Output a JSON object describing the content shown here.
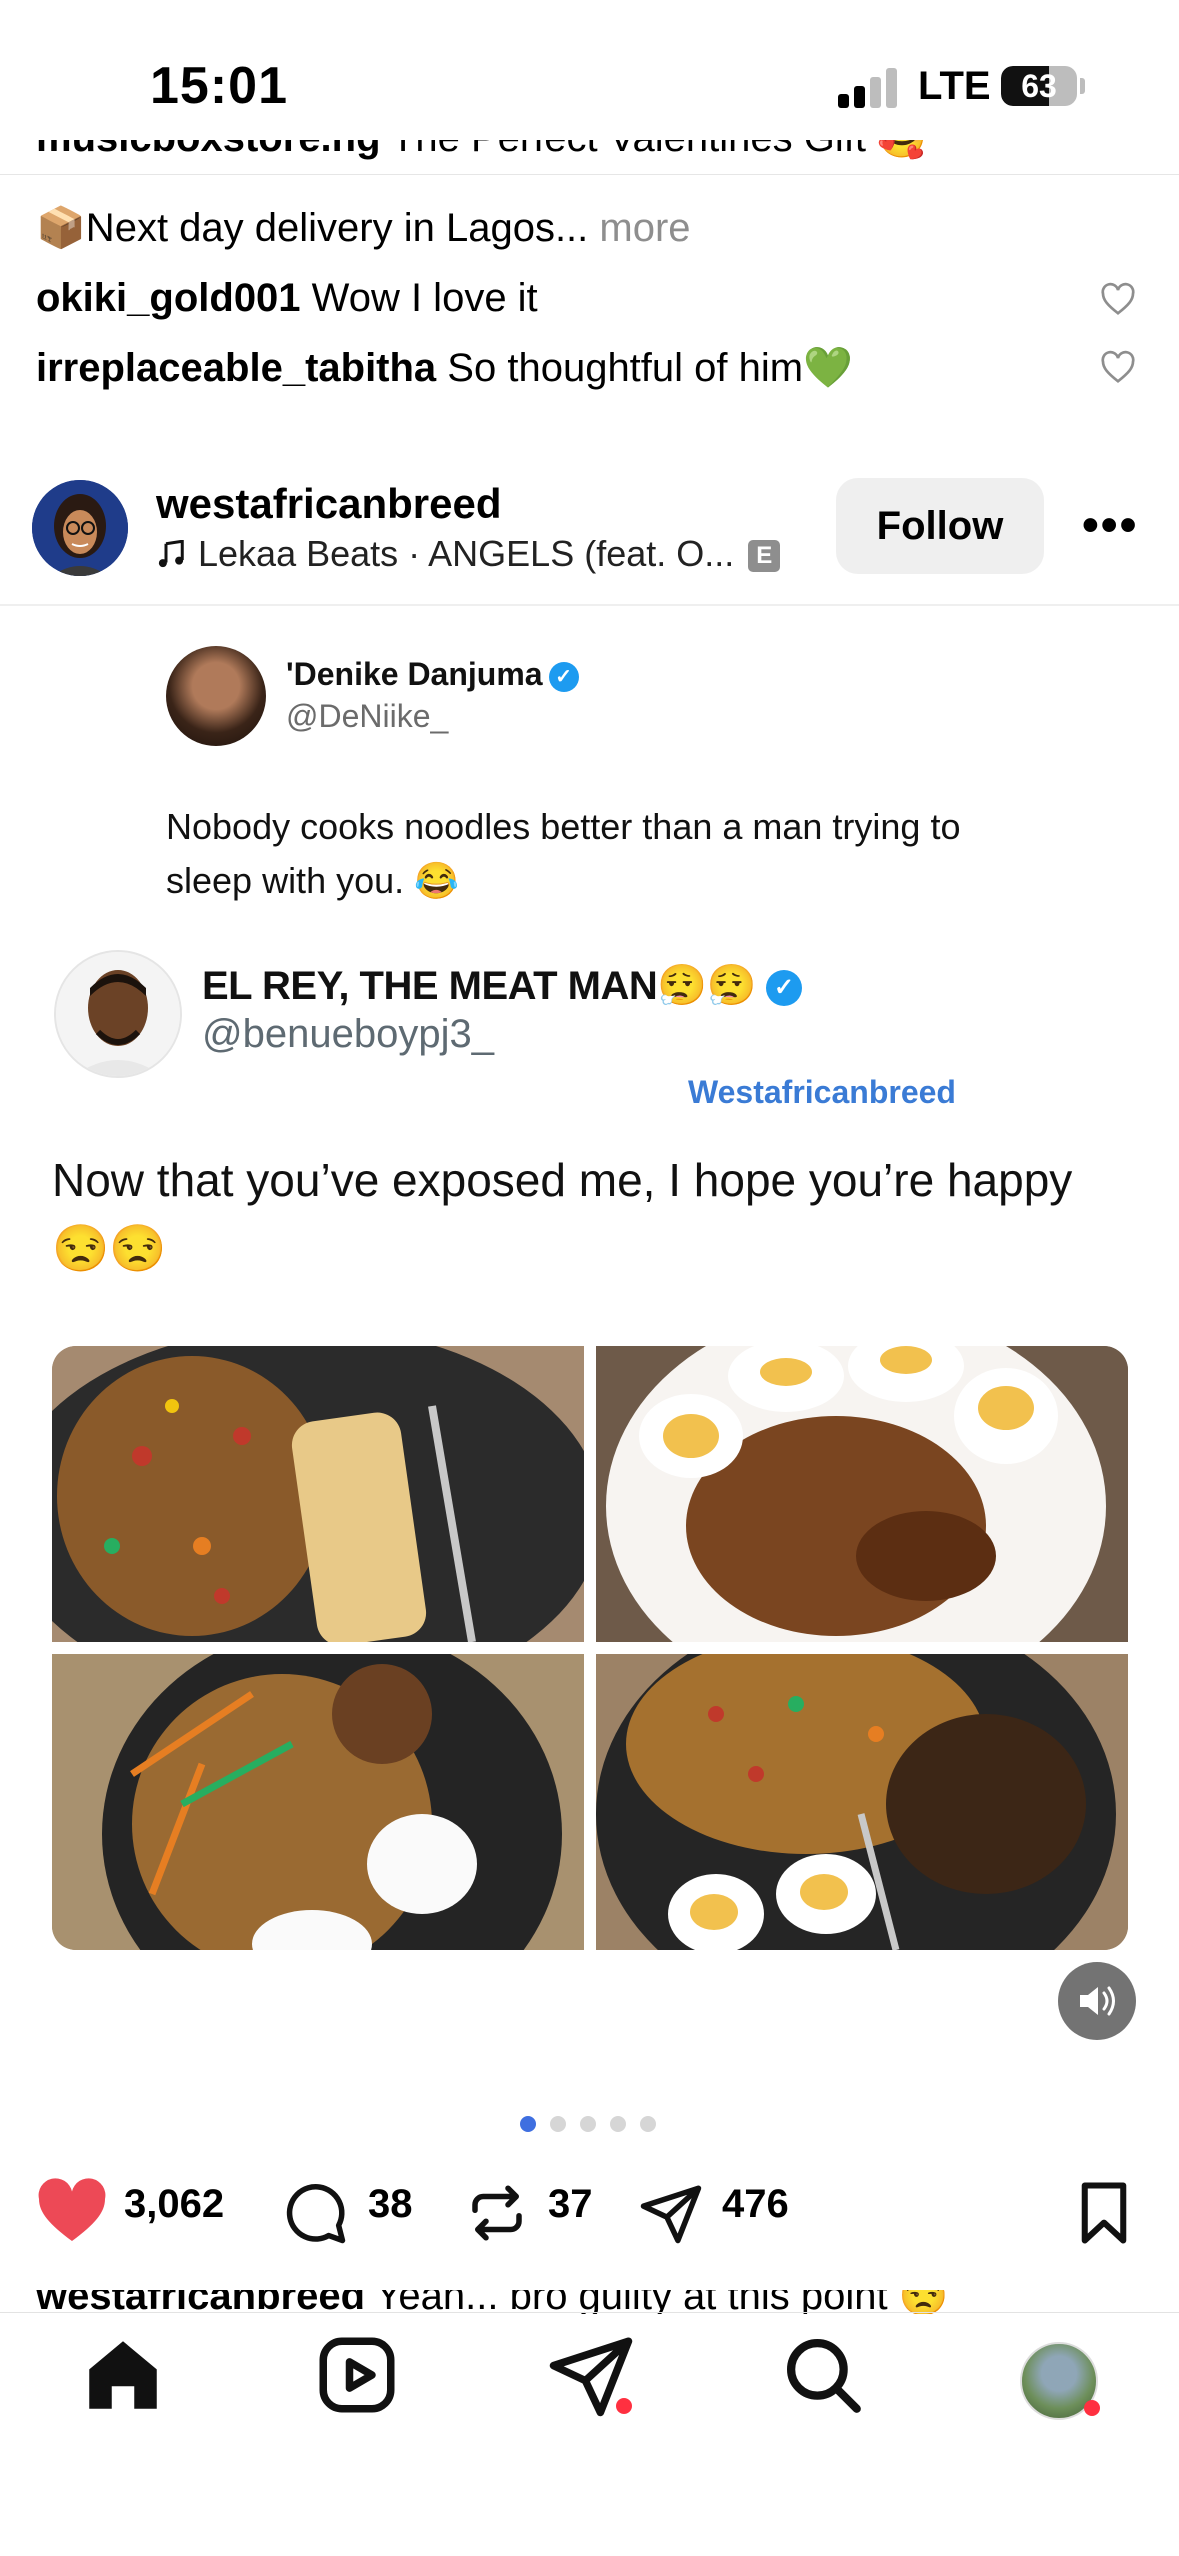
{
  "status_bar": {
    "time": "15:01",
    "network": "LTE",
    "battery": "63",
    "battery_level": 0.63,
    "signal_bars_active": 2,
    "signal_bars_total": 4
  },
  "previous_post": {
    "caption_clipped": {
      "username": "musicboxstore.ng",
      "text": " The Perfect Valentines Gift 🥰"
    },
    "caption_line2": "📦Next day delivery in Lagos...",
    "more_label": "more",
    "comments": [
      {
        "username": "okiki_gold001",
        "text": " Wow I love it"
      },
      {
        "username": "irreplaceable_tabitha",
        "text": " So thoughtful of him💚"
      }
    ]
  },
  "post": {
    "username": "westafricanbreed",
    "music": "Lekaa Beats · ANGELS (feat. O...",
    "explicit_badge": "E",
    "follow_label": "Follow",
    "more_label": "•••",
    "tweet1": {
      "name": "'Denike Danjuma",
      "handle": "@DeNiike_",
      "text": "Nobody cooks noodles better than a man trying to sleep with you. 😂"
    },
    "tweet2": {
      "name": "EL REY, THE MEAT MAN😮‍💨😮‍💨",
      "handle": "@benueboypj3_",
      "watermark": "Westafricanbreed",
      "text": "Now that you’ve exposed me, I hope you’re happy 😒😒"
    },
    "carousel": {
      "active_index": 0,
      "total": 5
    },
    "stats": {
      "likes": "3,062",
      "comments": "38",
      "reposts": "37",
      "shares": "476"
    },
    "caption_clipped": {
      "username": "westafricanbreed",
      "text": " Yeah... bro guilty at this point 😒"
    }
  },
  "colors": {
    "like_red": "#ed4956",
    "verified_blue": "#1d9bf0",
    "watermark_blue": "#3a7bd5",
    "notification_red": "#ff3040",
    "active_dot": "#3f6fe0"
  },
  "icons": {
    "like": "heart-filled-icon",
    "comment": "comment-bubble-icon",
    "repost": "repost-icon",
    "share": "send-icon",
    "save": "bookmark-icon",
    "mute": "speaker-icon",
    "nav": [
      "home-icon",
      "reels-icon",
      "messages-icon",
      "search-icon",
      "profile-avatar"
    ]
  }
}
